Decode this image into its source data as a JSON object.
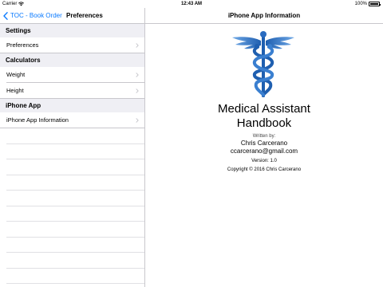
{
  "status_bar": {
    "carrier": "Carrier",
    "time": "12:43 AM",
    "battery_percent": "100%",
    "battery_level": 1.0
  },
  "master": {
    "back_label": "TOC - Book Order",
    "title": "Preferences",
    "sections": [
      {
        "header": "Settings",
        "rows": [
          "Preferences"
        ]
      },
      {
        "header": "Calculators",
        "rows": [
          "Weight",
          "Height"
        ]
      },
      {
        "header": "iPhone App",
        "rows": [
          "iPhone App Information"
        ]
      }
    ]
  },
  "detail": {
    "title": "iPhone App Information",
    "logo_icon": "caduceus-icon",
    "logo_color": "#1f5fb0",
    "app_title_line1": "Medical Assistant",
    "app_title_line2": "Handbook",
    "written_by_label": "Written by:",
    "author": "Chris Carcerano",
    "email": "ccarcerano@gmail.com",
    "version": "Version: 1.0",
    "copyright": "Copyright © 2016 Chris Carcerano"
  },
  "colors": {
    "accent": "#0a7aff",
    "section_bg": "#efeff4",
    "separator": "#c8c7cc"
  }
}
